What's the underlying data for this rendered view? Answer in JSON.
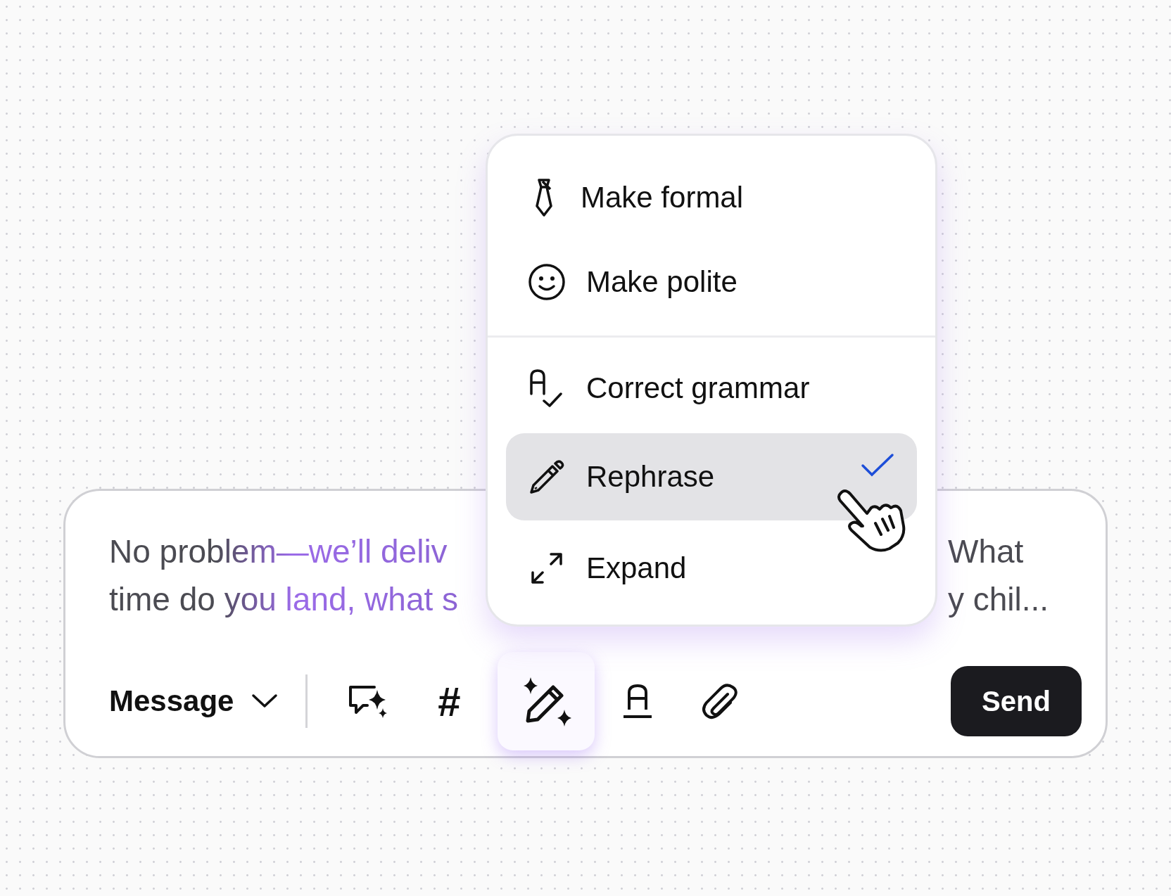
{
  "composer": {
    "message_lines": [
      {
        "left": "No problem—we’ll deliv",
        "right": "What"
      },
      {
        "left": "time do you land, what s",
        "right": "y chil..."
      }
    ],
    "mode_dropdown": {
      "label": "Message"
    },
    "toolbar": [
      {
        "kind": "comment-sparkle",
        "selected": false
      },
      {
        "kind": "hash",
        "label": "#",
        "selected": false
      },
      {
        "kind": "magic-pen",
        "selected": true
      },
      {
        "kind": "text-underline",
        "selected": false
      },
      {
        "kind": "paperclip",
        "selected": false
      }
    ],
    "send_button": {
      "label": "Send"
    }
  },
  "menu": {
    "groups": [
      [
        {
          "kind": "tie",
          "label": "Make formal",
          "selected": false
        },
        {
          "kind": "smile",
          "label": "Make polite",
          "selected": false
        }
      ],
      [
        {
          "kind": "grammar",
          "label": "Correct grammar",
          "selected": false
        },
        {
          "kind": "pencil",
          "label": "Rephrase",
          "selected": true
        },
        {
          "kind": "expand",
          "label": "Expand",
          "selected": false
        }
      ]
    ]
  }
}
